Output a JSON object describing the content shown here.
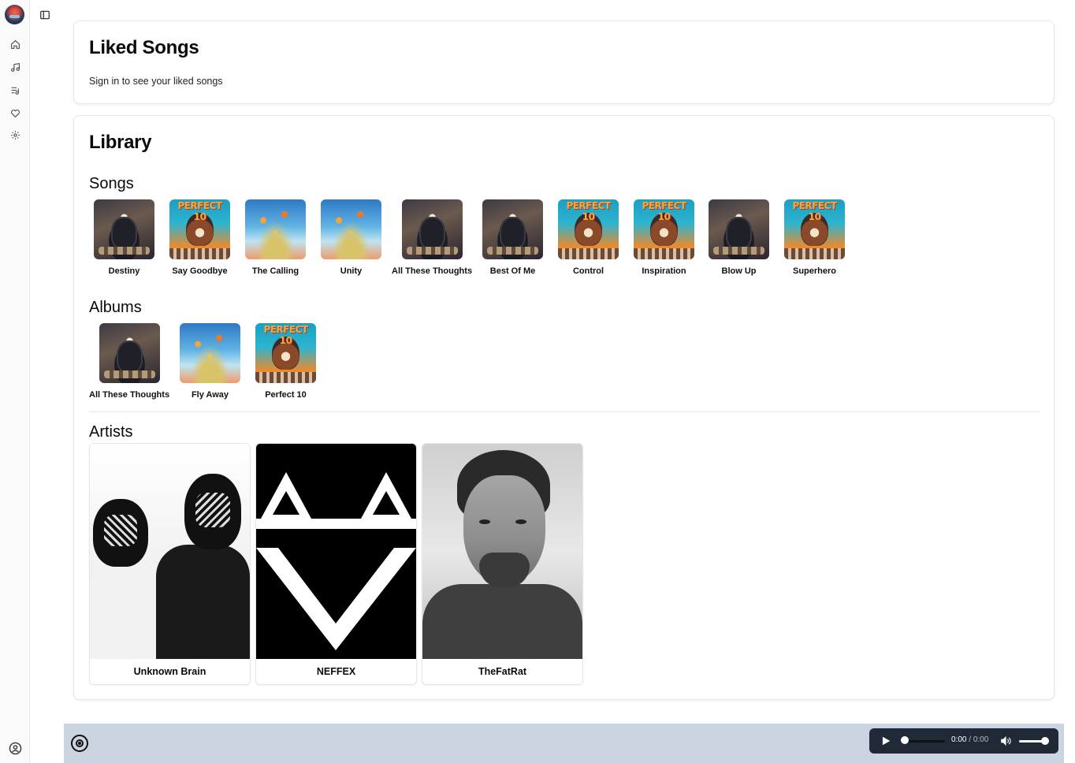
{
  "liked": {
    "title": "Liked Songs",
    "message": "Sign in to see your liked songs"
  },
  "library": {
    "title": "Library",
    "songs_heading": "Songs",
    "albums_heading": "Albums",
    "artists_heading": "Artists",
    "cover_text": "PERFECT 10",
    "songs": [
      {
        "title": "Destiny",
        "cover": "dark"
      },
      {
        "title": "Say Goodbye",
        "cover": "perfect"
      },
      {
        "title": "The Calling",
        "cover": "sky"
      },
      {
        "title": "Unity",
        "cover": "sky"
      },
      {
        "title": "All These Thoughts",
        "cover": "dark"
      },
      {
        "title": "Best Of Me",
        "cover": "dark"
      },
      {
        "title": "Control",
        "cover": "perfect"
      },
      {
        "title": "Inspiration",
        "cover": "perfect"
      },
      {
        "title": "Blow Up",
        "cover": "dark"
      },
      {
        "title": "Superhero",
        "cover": "perfect"
      }
    ],
    "albums": [
      {
        "title": "All These Thoughts",
        "cover": "dark"
      },
      {
        "title": "Fly Away",
        "cover": "sky"
      },
      {
        "title": "Perfect 10",
        "cover": "perfect"
      }
    ],
    "artists": [
      {
        "name": "Unknown Brain"
      },
      {
        "name": "NEFFEX"
      },
      {
        "name": "TheFatRat"
      }
    ]
  },
  "sidebar": {
    "icons": [
      "home-icon",
      "music-note-icon",
      "playlist-icon",
      "heart-icon",
      "settings-icon",
      "user-circle-icon"
    ]
  },
  "player": {
    "current_time": "0:00",
    "separator": "/",
    "duration": "0:00",
    "progress": 0,
    "volume": 1
  },
  "colors": {
    "player_bar": "#cbd5e1",
    "audio_control": "#1f2937"
  }
}
